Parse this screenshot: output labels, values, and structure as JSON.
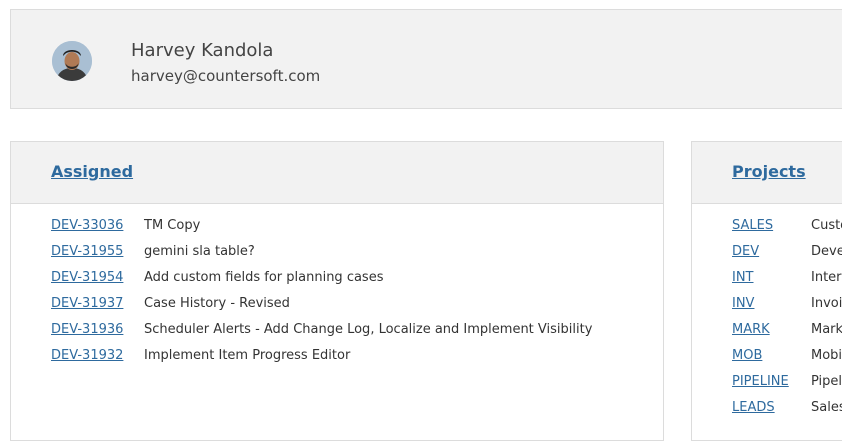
{
  "profile": {
    "name": "Harvey Kandola",
    "email": "harvey@countersoft.com",
    "avatar_icon": "user-avatar-icon"
  },
  "assigned": {
    "title": "Assigned",
    "items": [
      {
        "key": "DEV-33036",
        "title": "TM Copy"
      },
      {
        "key": "DEV-31955",
        "title": "gemini sla table?"
      },
      {
        "key": "DEV-31954",
        "title": "Add custom fields for planning cases"
      },
      {
        "key": "DEV-31937",
        "title": "Case History - Revised"
      },
      {
        "key": "DEV-31936",
        "title": "Scheduler Alerts - Add Change Log, Localize and Implement Visibility"
      },
      {
        "key": "DEV-31932",
        "title": "Implement Item Progress Editor"
      }
    ]
  },
  "projects": {
    "title": "Projects",
    "items": [
      {
        "code": "SALES",
        "name": "Custo"
      },
      {
        "code": "DEV",
        "name": "Deve"
      },
      {
        "code": "INT",
        "name": "Inter"
      },
      {
        "code": "INV",
        "name": "Invoi"
      },
      {
        "code": "MARK",
        "name": "Mark"
      },
      {
        "code": "MOB",
        "name": "Mobi"
      },
      {
        "code": "PIPELINE",
        "name": "Pipel"
      },
      {
        "code": "LEADS",
        "name": "Sales"
      }
    ]
  },
  "colors": {
    "link": "#2e6a9e",
    "panel_bg": "#f2f2f2",
    "border": "#dcdcdc"
  }
}
